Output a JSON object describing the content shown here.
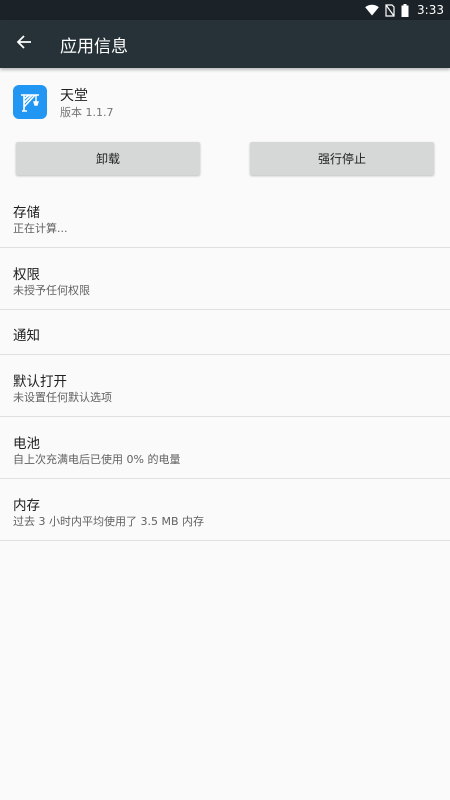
{
  "status_bar": {
    "time": "3:33",
    "icons": [
      "wifi-icon",
      "no-sim-icon",
      "battery-icon"
    ]
  },
  "toolbar": {
    "back_icon": "arrow-left-icon",
    "title": "应用信息"
  },
  "app": {
    "icon": "crane-app-icon",
    "name": "天堂",
    "version": "版本 1.1.7"
  },
  "buttons": {
    "uninstall": "卸载",
    "force_stop": "强行停止"
  },
  "items": [
    {
      "title": "存储",
      "subtitle": "正在计算..."
    },
    {
      "title": "权限",
      "subtitle": "未授予任何权限"
    },
    {
      "title": "通知",
      "subtitle": ""
    },
    {
      "title": "默认打开",
      "subtitle": "未设置任何默认选项"
    },
    {
      "title": "电池",
      "subtitle": "自上次充满电后已使用 0% 的电量"
    },
    {
      "title": "内存",
      "subtitle": "过去 3 小时内平均使用了 3.5 MB 内存"
    }
  ],
  "colors": {
    "status_bar": "#1b2328",
    "toolbar": "#263238",
    "app_icon": "#2196f3",
    "button": "#d6d7d7",
    "background": "#fafafa"
  }
}
